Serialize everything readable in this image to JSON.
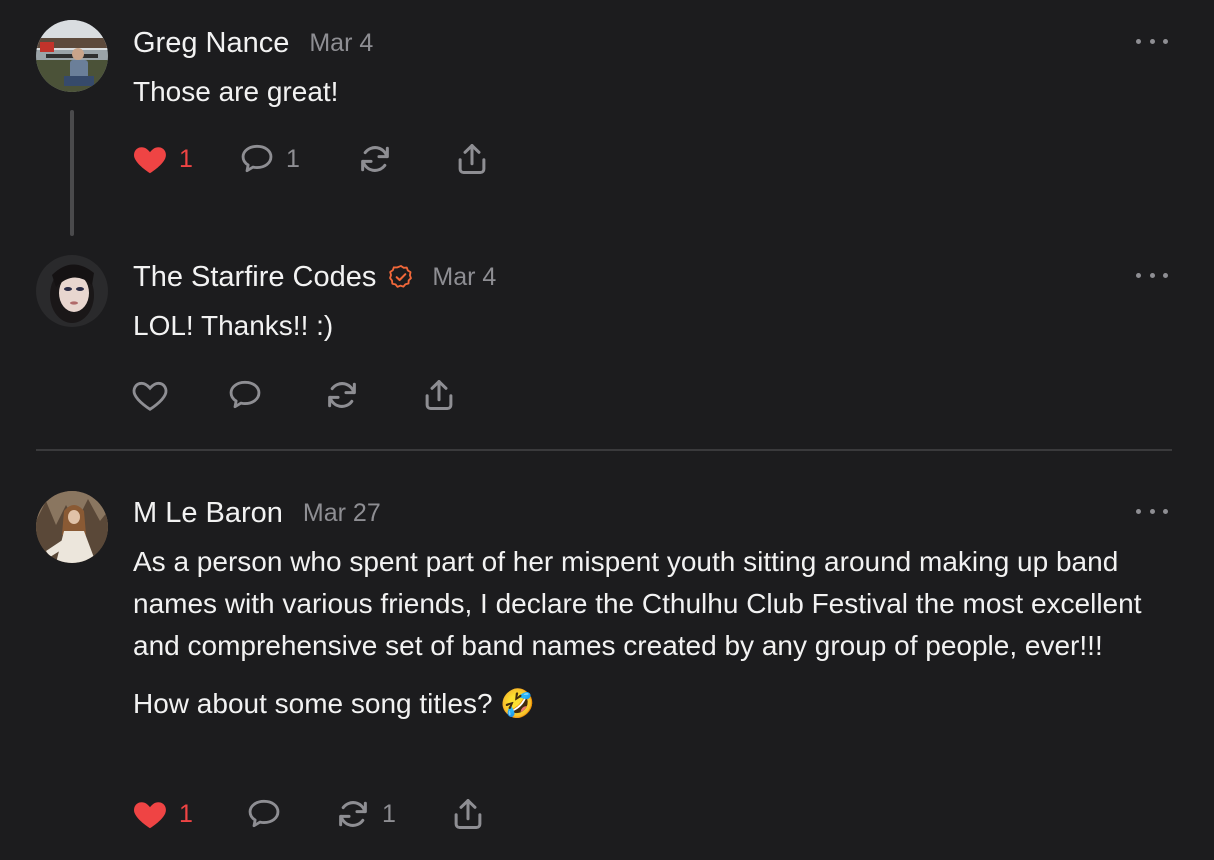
{
  "colors": {
    "background": "#1c1c1e",
    "text": "#f2f2f2",
    "muted": "#8e8e93",
    "like_red": "#ef4444",
    "verified_orange": "#f2683a"
  },
  "comments": [
    {
      "author": "Greg Nance",
      "date": "Mar 4",
      "verified": false,
      "body": [
        "Those are great!"
      ],
      "actions": {
        "like": {
          "icon": "heart-filled-icon",
          "count": "1",
          "liked": true
        },
        "reply": {
          "icon": "comment-icon",
          "count": "1"
        },
        "restack": {
          "icon": "restack-icon",
          "count": ""
        },
        "share": {
          "icon": "share-icon"
        }
      }
    },
    {
      "author": "The Starfire Codes",
      "date": "Mar 4",
      "verified": true,
      "body": [
        "LOL! Thanks!! :)"
      ],
      "actions": {
        "like": {
          "icon": "heart-outline-icon",
          "count": "",
          "liked": false
        },
        "reply": {
          "icon": "comment-icon",
          "count": ""
        },
        "restack": {
          "icon": "restack-icon",
          "count": ""
        },
        "share": {
          "icon": "share-icon"
        }
      }
    },
    {
      "author": "M Le Baron",
      "date": "Mar 27",
      "verified": false,
      "body": [
        "As a person who spent part of her mispent youth sitting around making up band names with various friends, I declare the Cthulhu Club Festival the most excellent and comprehensive set of band names created by any group of people, ever!!!",
        "How about some song titles? 🤣"
      ],
      "actions": {
        "like": {
          "icon": "heart-filled-icon",
          "count": "1",
          "liked": true
        },
        "reply": {
          "icon": "comment-icon",
          "count": ""
        },
        "restack": {
          "icon": "restack-icon",
          "count": "1"
        },
        "share": {
          "icon": "share-icon"
        }
      }
    }
  ]
}
